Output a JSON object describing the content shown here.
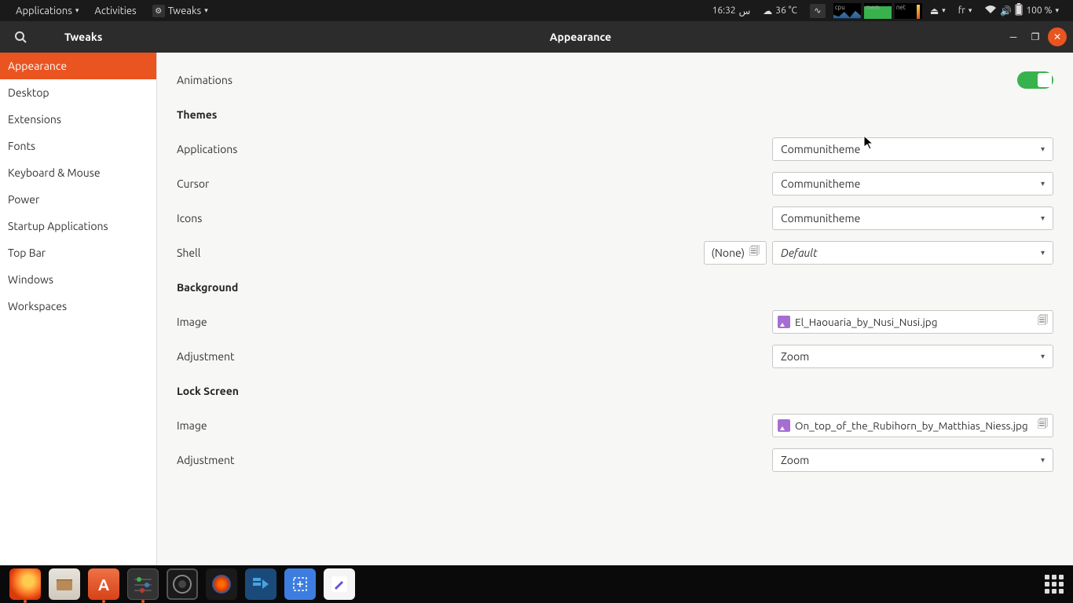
{
  "top_panel": {
    "applications": "Applications",
    "activities": "Activities",
    "current_app": "Tweaks",
    "time": "16:32",
    "time_suffix": "س",
    "weather": "36 °C",
    "lang": "fr",
    "battery": "100 %"
  },
  "window": {
    "app_name": "Tweaks",
    "title": "Appearance"
  },
  "sidebar": {
    "items": [
      "Appearance",
      "Desktop",
      "Extensions",
      "Fonts",
      "Keyboard & Mouse",
      "Power",
      "Startup Applications",
      "Top Bar",
      "Windows",
      "Workspaces"
    ],
    "active_index": 0
  },
  "main": {
    "animations_label": "Animations",
    "themes_heading": "Themes",
    "themes": {
      "applications": {
        "label": "Applications",
        "value": "Communitheme"
      },
      "cursor": {
        "label": "Cursor",
        "value": "Communitheme"
      },
      "icons": {
        "label": "Icons",
        "value": "Communitheme"
      },
      "shell": {
        "label": "Shell",
        "none": "(None)",
        "value": "Default"
      }
    },
    "background_heading": "Background",
    "background": {
      "image_label": "Image",
      "image_value": "El_Haouaria_by_Nusi_Nusi.jpg",
      "adjustment_label": "Adjustment",
      "adjustment_value": "Zoom"
    },
    "lockscreen_heading": "Lock Screen",
    "lockscreen": {
      "image_label": "Image",
      "image_value": "On_top_of_the_Rubihorn_by_Matthias_Niess.jpg",
      "adjustment_label": "Adjustment",
      "adjustment_value": "Zoom"
    }
  }
}
